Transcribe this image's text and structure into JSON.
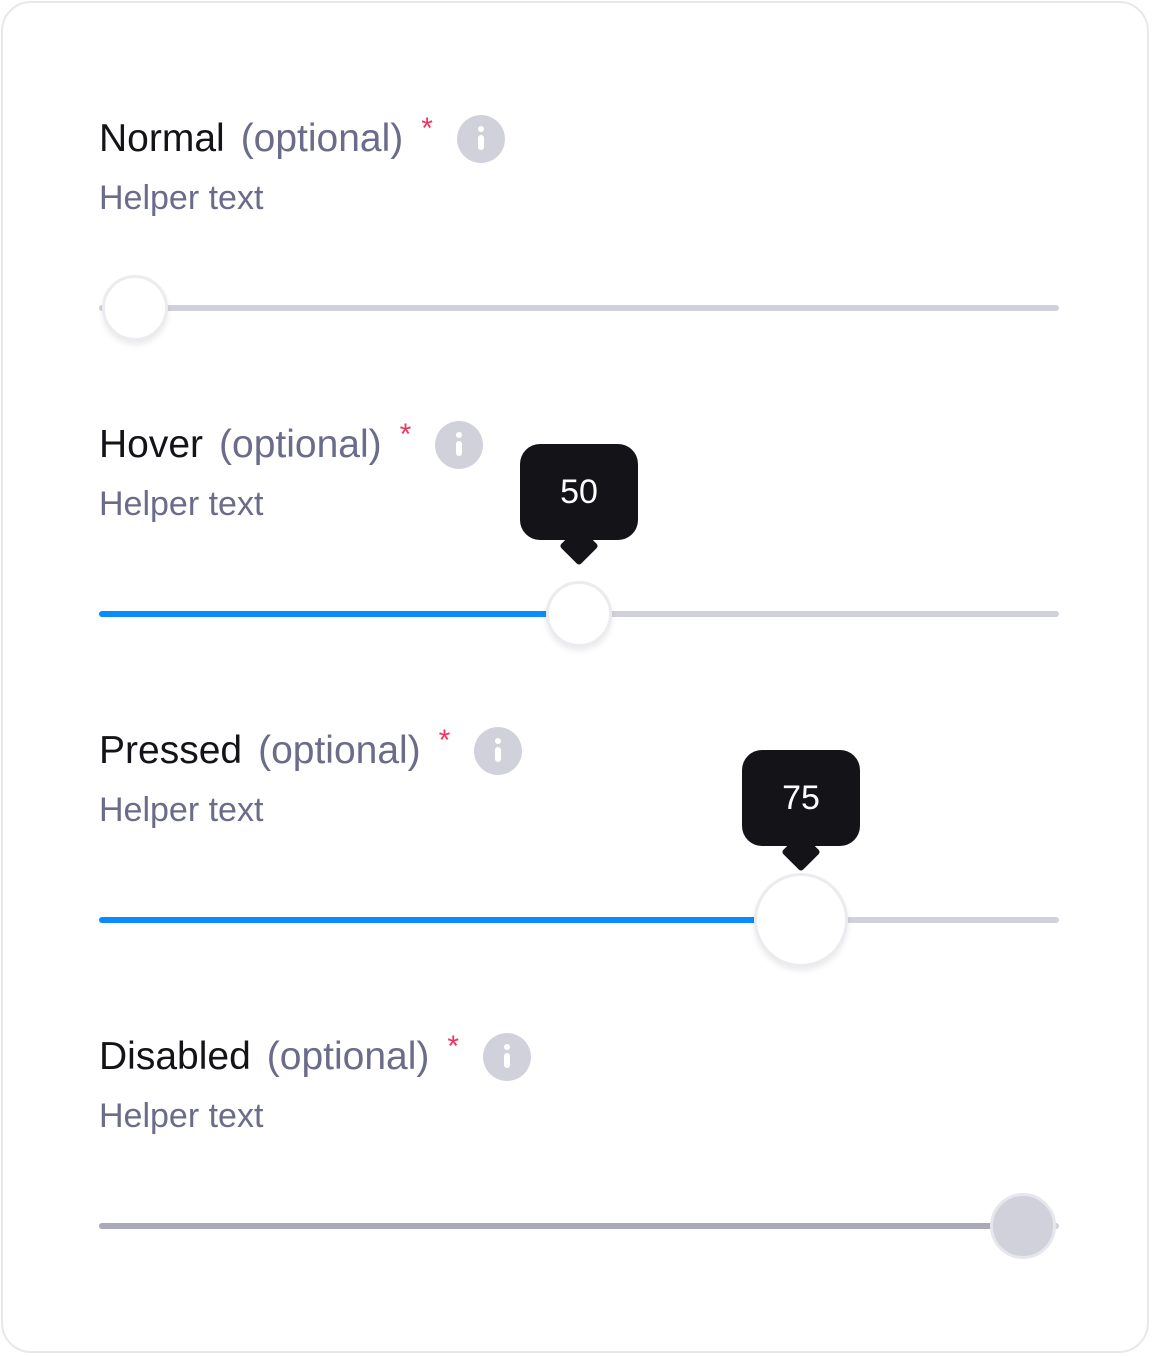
{
  "colors": {
    "accent": "#0a8cff",
    "track": "#d1d1dc",
    "disabled_fill": "#a9a9b8",
    "required": "#f0355f",
    "tooltip_bg": "#131318"
  },
  "sliders": [
    {
      "state": "normal",
      "label": "Normal",
      "optional": "(optional)",
      "required": "*",
      "info_icon": "info-icon",
      "helper": "Helper text",
      "value": 0,
      "min": 0,
      "max": 100,
      "tooltip": null
    },
    {
      "state": "hover",
      "label": "Hover",
      "optional": "(optional)",
      "required": "*",
      "info_icon": "info-icon",
      "helper": "Helper text",
      "value": 50,
      "min": 0,
      "max": 100,
      "tooltip": "50"
    },
    {
      "state": "pressed",
      "label": "Pressed",
      "optional": "(optional)",
      "required": "*",
      "info_icon": "info-icon",
      "helper": "Helper text",
      "value": 75,
      "min": 0,
      "max": 100,
      "tooltip": "75"
    },
    {
      "state": "disabled",
      "label": "Disabled",
      "optional": "(optional)",
      "required": "*",
      "info_icon": "info-icon",
      "helper": "Helper text",
      "value": 100,
      "min": 0,
      "max": 100,
      "tooltip": null
    }
  ]
}
